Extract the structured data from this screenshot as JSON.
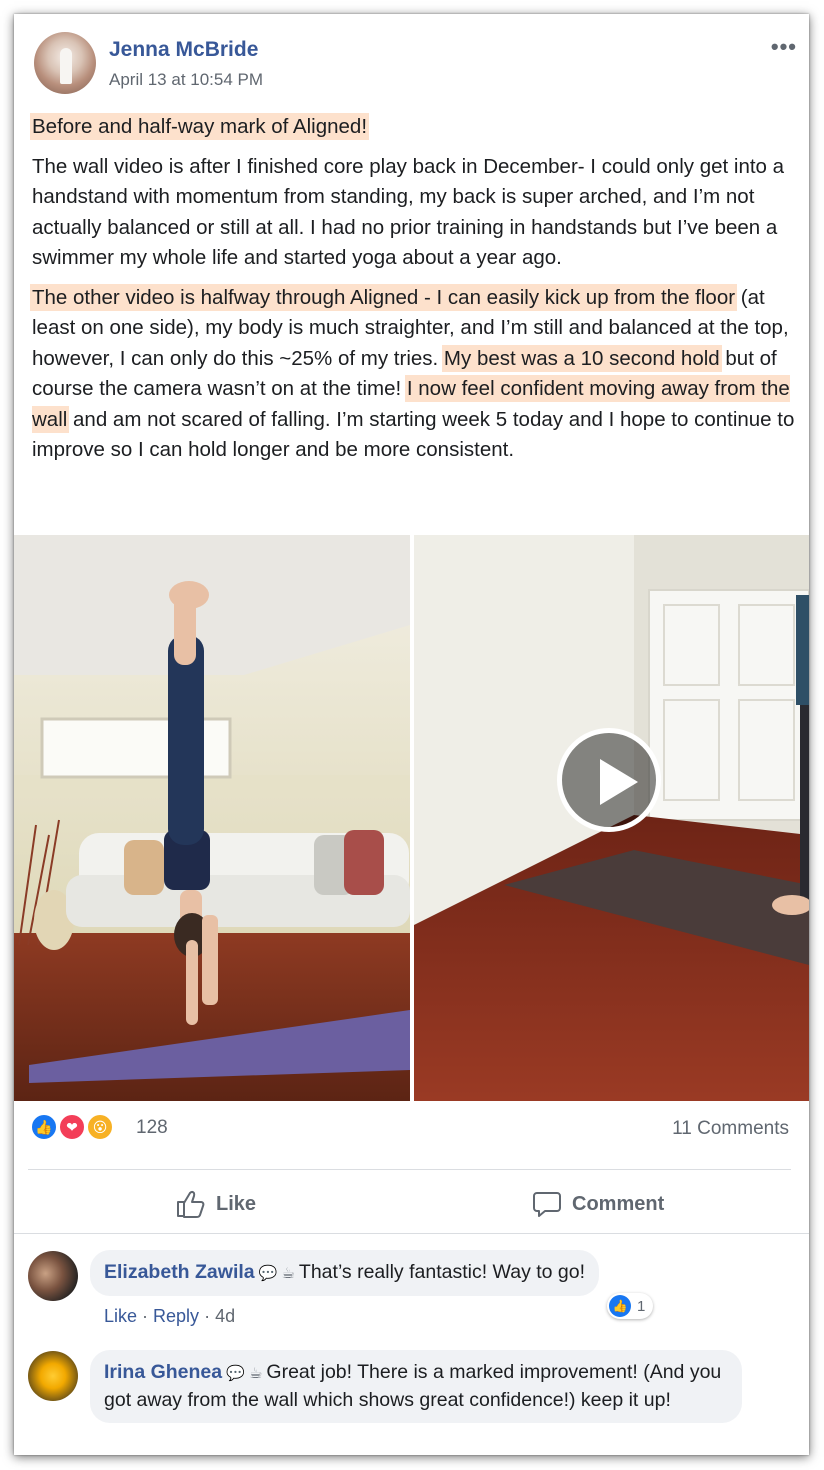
{
  "post": {
    "author": "Jenna McBride",
    "timestamp": "April 13 at 10:54 PM",
    "more_label": "•••",
    "p1": "Before and half-way mark of Aligned!",
    "p2": "The wall video is after I finished core play back in December- I could only get into a handstand with momentum from standing, my back is super arched, and I’m not actually balanced or still at all. I had no prior training in handstands but I’ve been a swimmer my whole life and started yoga about a year ago.",
    "p3a": "The other video is halfway through Aligned - I can easily kick up from the floor",
    "p3b": " (at least on one side), my body is much straighter, and I’m still and balanced at the top, however, I can only do this ~25% of my tries. ",
    "p3c": "My best was a 10 second hold",
    "p3d": " but of course the camera wasn’t on at the time! ",
    "p3e": "I now feel confident moving away from the wall",
    "p3f": " and am not scared of falling. I’m starting week 5 today and I hope to continue to improve so I can hold longer and be more consistent.",
    "highlight_color": "#fde1cc"
  },
  "reactions": {
    "icons": [
      "like-icon",
      "love-icon",
      "wow-icon"
    ],
    "count": "128",
    "comments_count": "11 Comments"
  },
  "actions": {
    "like_label": "Like",
    "comment_label": "Comment"
  },
  "comments": [
    {
      "name": "Elizabeth Zawila",
      "text": "That’s really fantastic! Way to go!",
      "like_label": "Like",
      "reply_label": "Reply",
      "age": "4d",
      "reaction_count": "1"
    },
    {
      "name": "Irina Ghenea",
      "text": "Great job! There is a marked improvement! (And you got away from the wall which shows great confidence!) keep it up!"
    }
  ],
  "colors": {
    "link_blue": "#385898",
    "like_blue": "#1877f2",
    "love_red": "#f33e58",
    "wow_yellow": "#f7b125",
    "meta_gray": "#606770"
  }
}
